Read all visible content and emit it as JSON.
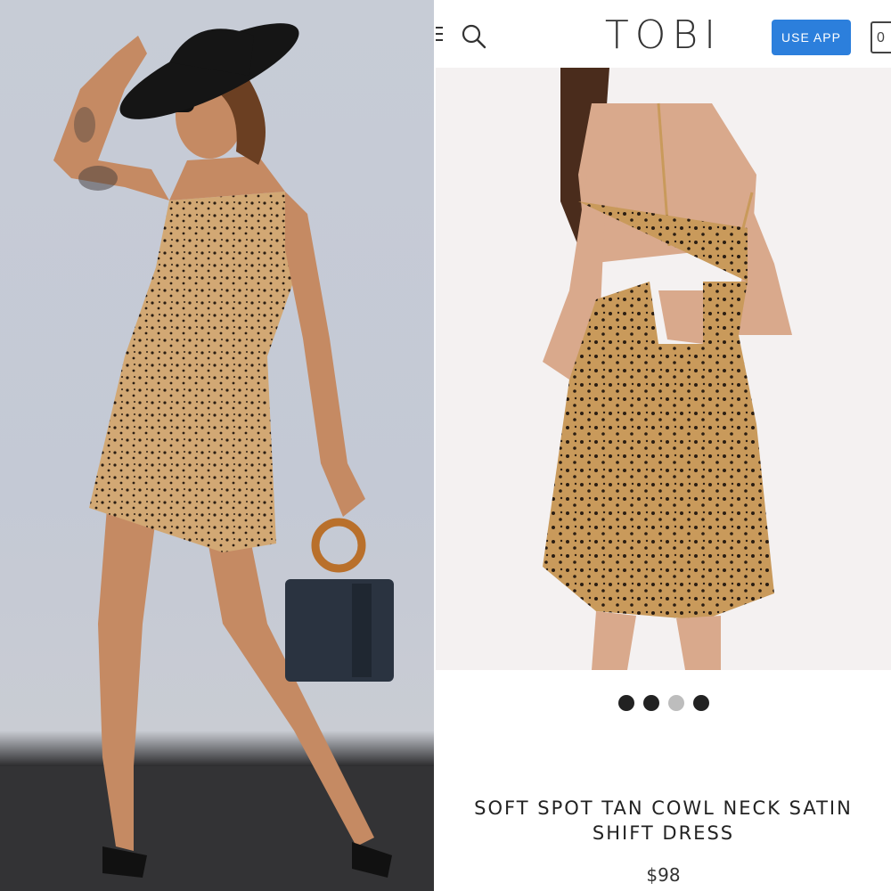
{
  "header": {
    "brand": "TOBI",
    "use_app_label": "USE APP",
    "cart_count": "0"
  },
  "carousel": {
    "total": 4,
    "active_index": 2
  },
  "product": {
    "title_line1": "SOFT SPOT TAN COWL NECK SATIN",
    "title_line2": "SHIFT DRESS",
    "price": "$98"
  },
  "colors": {
    "accent": "#2c7fdc",
    "dress_tan": "#c99a5b",
    "dot_active": "#222222",
    "dot_inactive": "#bdbdbd"
  }
}
